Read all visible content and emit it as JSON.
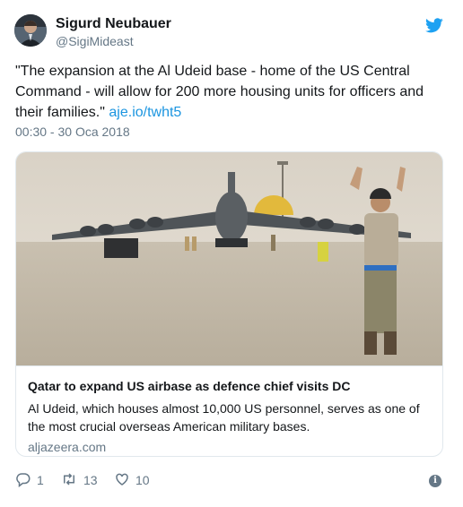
{
  "author": {
    "name": "Sigurd Neubauer",
    "handle": "@SigiMideast"
  },
  "tweet": {
    "text": "\"The expansion at the Al Udeid base - home of the US Central Command - will allow for 200 more housing units for officers and their families.\"",
    "link": "aje.io/twht5",
    "timestamp": "00:30 - 30 Oca 2018"
  },
  "card": {
    "title": "Qatar to expand US airbase as defence chief visits DC",
    "description": "Al Udeid, which houses almost 10,000 US personnel, serves as one of the most crucial overseas American military bases.",
    "domain": "aljazeera.com"
  },
  "actions": {
    "replies": "1",
    "retweets": "13",
    "likes": "10"
  },
  "colors": {
    "link": "#1b95e0",
    "twitter_blue": "#1da1f2",
    "muted": "#657786",
    "border": "#e1e8ed"
  },
  "icons": {
    "reply": "reply-icon",
    "retweet": "retweet-icon",
    "like": "heart-icon",
    "info": "info-icon",
    "brand": "twitter-bird-icon"
  }
}
